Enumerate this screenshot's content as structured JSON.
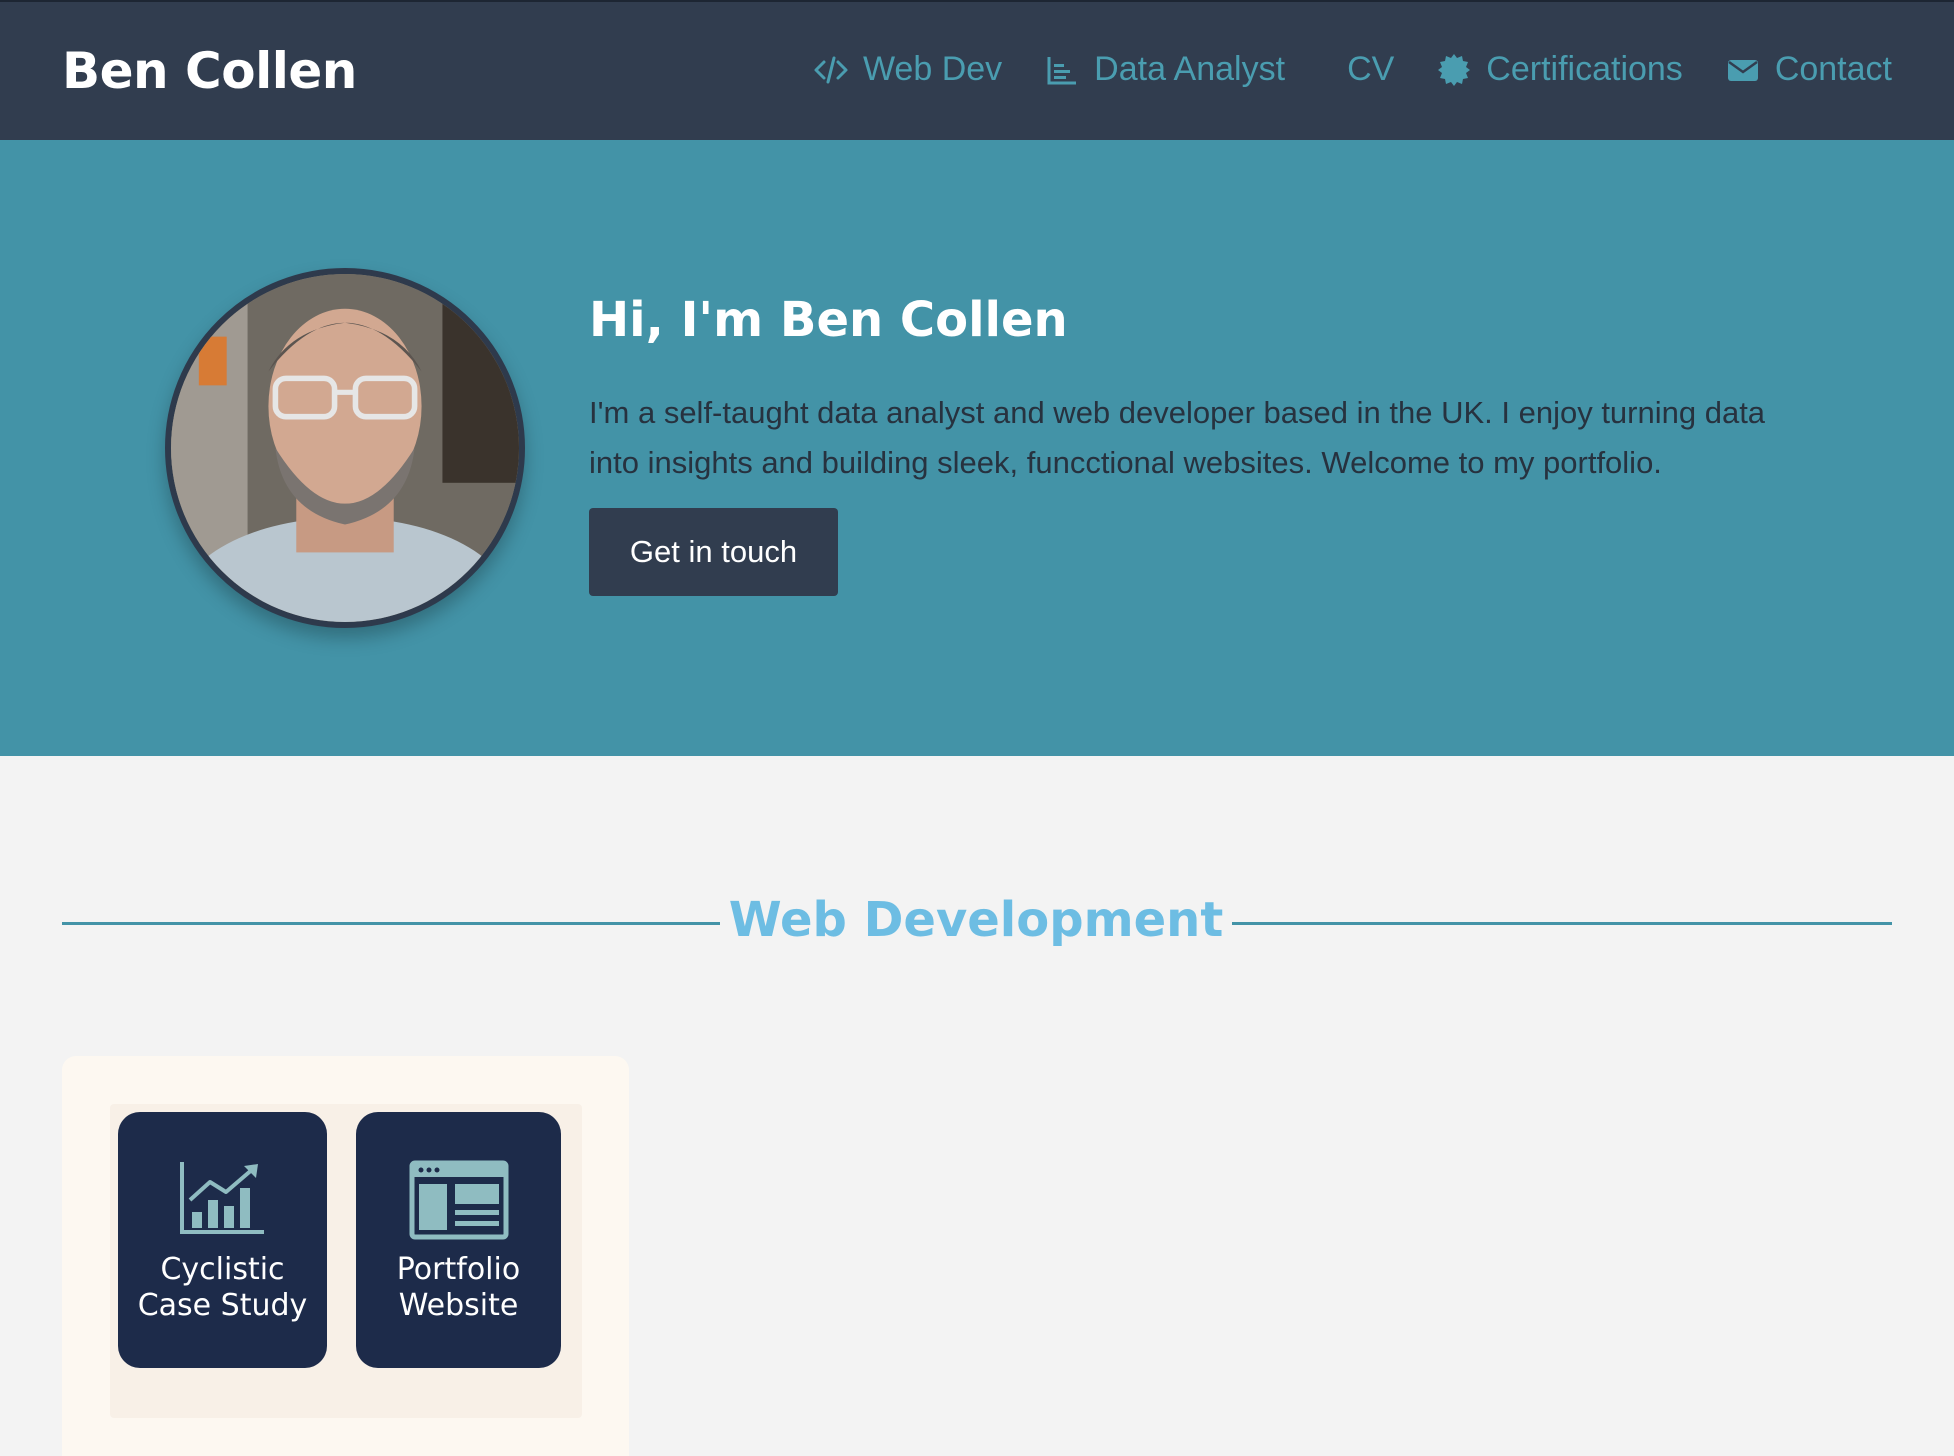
{
  "header": {
    "brand": "Ben Collen",
    "nav": [
      {
        "label": "Web Dev",
        "icon": "code-icon"
      },
      {
        "label": "Data Analyst",
        "icon": "bar-chart-icon"
      },
      {
        "label": "CV",
        "icon": ""
      },
      {
        "label": "Certifications",
        "icon": "badge-icon"
      },
      {
        "label": "Contact",
        "icon": "envelope-icon"
      }
    ]
  },
  "hero": {
    "title": "Hi, I'm Ben Collen",
    "text": "I'm a self-taught data analyst and web developer based in the UK. I enjoy turning data into insights and building sleek, funcctional websites. Welcome to my portfolio.",
    "cta": "Get in touch"
  },
  "section": {
    "title": "Web Development"
  },
  "projects": [
    {
      "line1": "Cyclistic",
      "line2": "Case Study",
      "icon": "growth-chart-icon"
    },
    {
      "line1": "Portfolio",
      "line2": "Website",
      "icon": "browser-window-icon"
    }
  ],
  "colors": {
    "header_bg": "#313d4f",
    "hero_bg": "#4393a7",
    "accent": "#4a9db0",
    "section_title": "#6dbde3",
    "tile_bg": "#1d2b4a",
    "page_bg": "#f3f3f3"
  }
}
